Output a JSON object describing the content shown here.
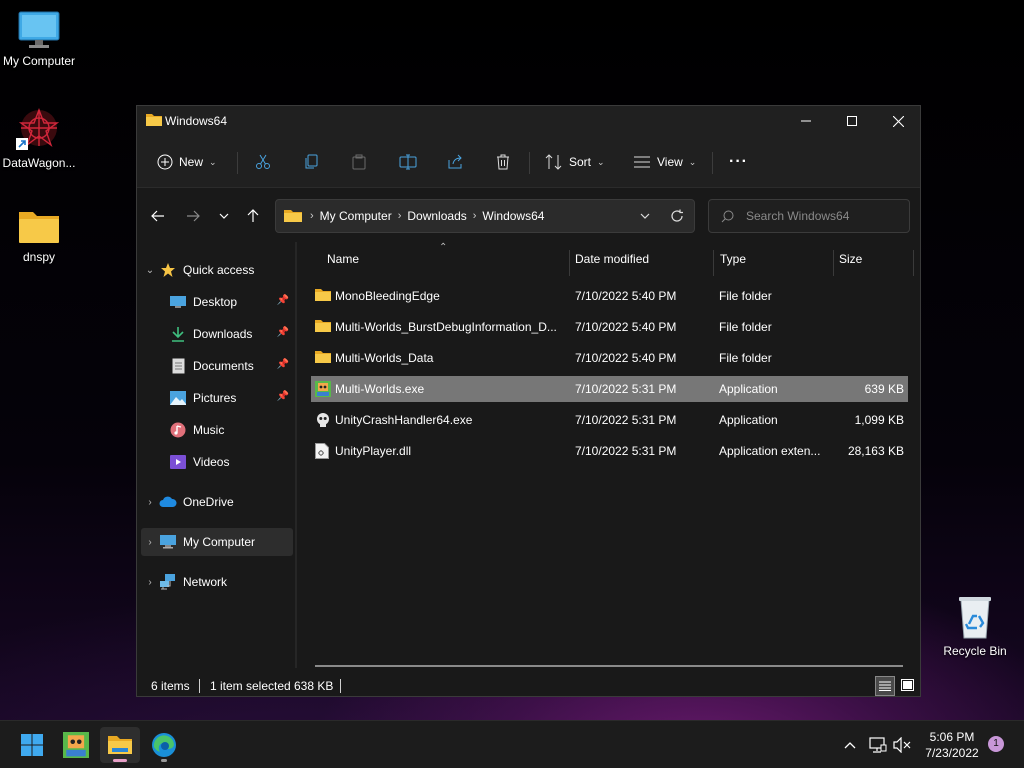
{
  "desktop": {
    "icons": [
      {
        "label": "My Computer",
        "icon": "monitor-icon"
      },
      {
        "label": "DataWagon...",
        "icon": "app-shortcut-icon"
      },
      {
        "label": "dnspy",
        "icon": "folder-icon"
      },
      {
        "label": "Recycle Bin",
        "icon": "recycle-bin-icon"
      }
    ]
  },
  "window": {
    "title": "Windows64",
    "toolbar": {
      "new_label": "New",
      "sort_label": "Sort",
      "view_label": "View",
      "more_label": "···"
    },
    "address": {
      "crumbs": [
        "My Computer",
        "Downloads",
        "Windows64"
      ]
    },
    "search": {
      "placeholder": "Search Windows64"
    },
    "nav": {
      "quick_access": "Quick access",
      "items": [
        {
          "label": "Desktop",
          "pinned": true
        },
        {
          "label": "Downloads",
          "pinned": true
        },
        {
          "label": "Documents",
          "pinned": true
        },
        {
          "label": "Pictures",
          "pinned": true
        },
        {
          "label": "Music",
          "pinned": false
        },
        {
          "label": "Videos",
          "pinned": false
        }
      ],
      "onedrive": "OneDrive",
      "my_computer": "My Computer",
      "network": "Network"
    },
    "columns": {
      "name": "Name",
      "date": "Date modified",
      "type": "Type",
      "size": "Size"
    },
    "files": [
      {
        "name": "MonoBleedingEdge",
        "date": "7/10/2022 5:40 PM",
        "type": "File folder",
        "size": "",
        "icon": "folder-icon"
      },
      {
        "name": "Multi-Worlds_BurstDebugInformation_D...",
        "date": "7/10/2022 5:40 PM",
        "type": "File folder",
        "size": "",
        "icon": "folder-icon"
      },
      {
        "name": "Multi-Worlds_Data",
        "date": "7/10/2022 5:40 PM",
        "type": "File folder",
        "size": "",
        "icon": "folder-icon"
      },
      {
        "name": "Multi-Worlds.exe",
        "date": "7/10/2022 5:31 PM",
        "type": "Application",
        "size": "639 KB",
        "icon": "game-exe-icon",
        "selected": true
      },
      {
        "name": "UnityCrashHandler64.exe",
        "date": "7/10/2022 5:31 PM",
        "type": "Application",
        "size": "1,099 KB",
        "icon": "crash-handler-icon"
      },
      {
        "name": "UnityPlayer.dll",
        "date": "7/10/2022 5:31 PM",
        "type": "Application exten...",
        "size": "28,163 KB",
        "icon": "dll-icon"
      }
    ],
    "status": {
      "items": "6 items",
      "selected": "1 item selected",
      "size": "638 KB"
    }
  },
  "taskbar": {
    "clock_time": "5:06 PM",
    "clock_date": "7/23/2022",
    "notifications": "1"
  },
  "colors": {
    "window_bg": "#191919",
    "selected_row": "#777777",
    "folder": "#f6c445",
    "accent": "#4aa3df"
  }
}
